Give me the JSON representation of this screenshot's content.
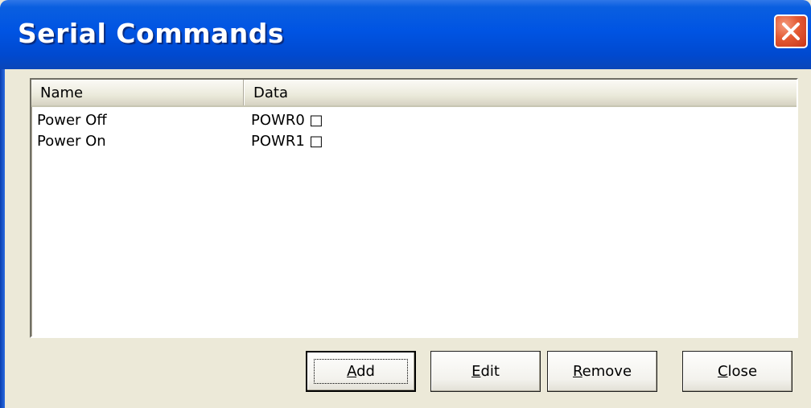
{
  "window": {
    "title": "Serial Commands",
    "close_icon": "close-x-icon",
    "accent_color": "#0054e3",
    "close_color": "#e45a33"
  },
  "list": {
    "columns": [
      {
        "label": "Name"
      },
      {
        "label": "Data"
      }
    ],
    "rows": [
      {
        "name": "Power Off",
        "data": "POWR0 □"
      },
      {
        "name": "Power On",
        "data": "POWR1 □"
      }
    ]
  },
  "buttons": {
    "add": {
      "mnemonic": "A",
      "rest": "dd"
    },
    "edit": {
      "mnemonic": "E",
      "rest": "dit"
    },
    "remove": {
      "mnemonic": "R",
      "rest": "emove"
    },
    "close": {
      "mnemonic": "C",
      "rest": "lose"
    }
  }
}
